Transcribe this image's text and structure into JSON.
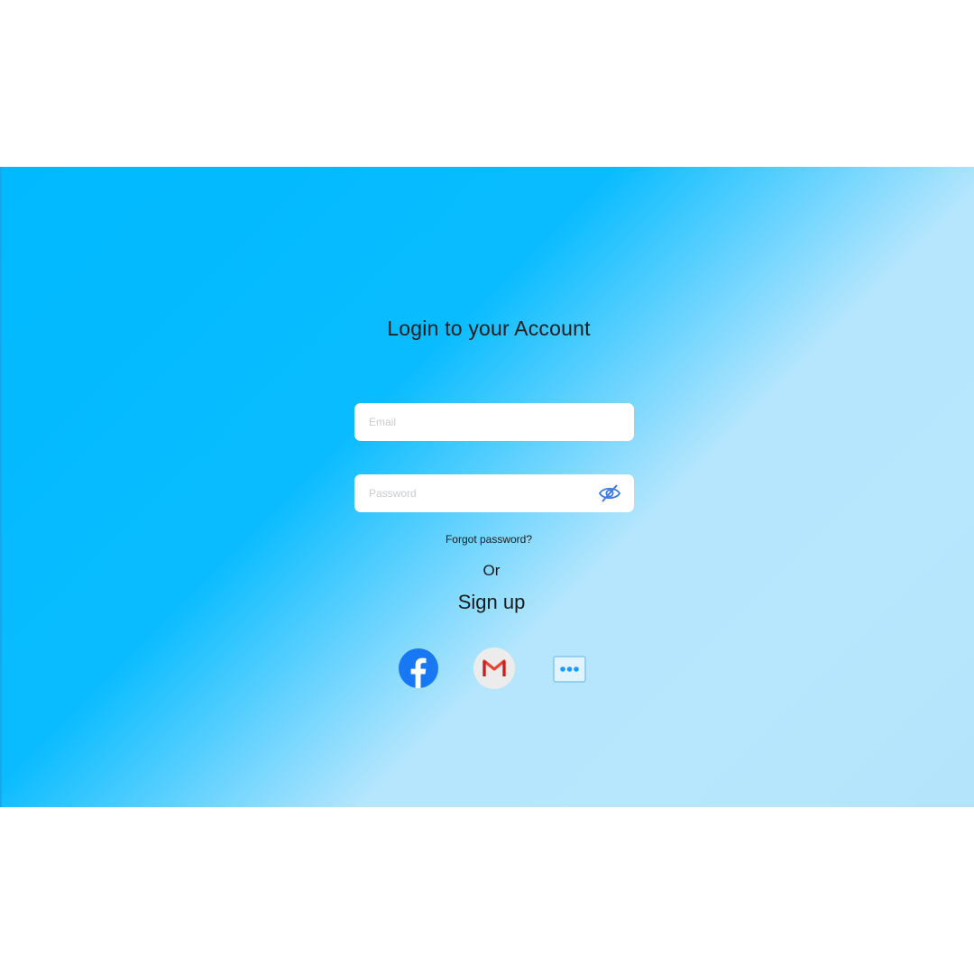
{
  "login": {
    "title": "Login to your Account",
    "email": {
      "placeholder": "Email",
      "value": ""
    },
    "password": {
      "placeholder": "Password",
      "value": ""
    },
    "forgot_label": "Forgot password?",
    "or_label": "Or",
    "signup_label": "Sign up"
  },
  "social": [
    {
      "icon": "facebook-icon",
      "color": "#1877f2"
    },
    {
      "icon": "gmail-icon",
      "color": "#ea4335"
    },
    {
      "icon": "more-options-icon",
      "color": "#1a9bff"
    }
  ],
  "colors": {
    "gradient_start": "#00b9ff",
    "gradient_end": "#b7e7fd",
    "eye_icon": "#3d7be0"
  }
}
